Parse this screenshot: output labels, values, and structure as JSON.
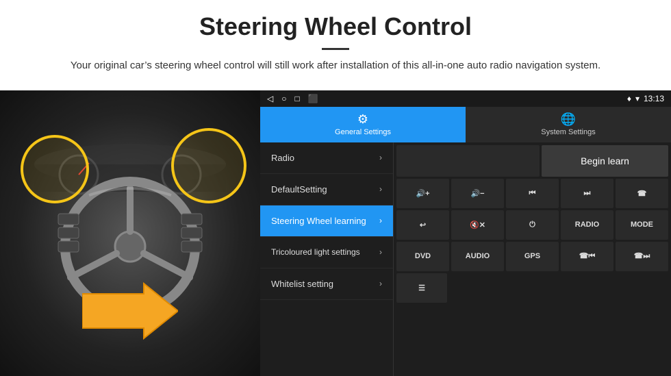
{
  "header": {
    "title": "Steering Wheel Control",
    "subtitle": "Your original car’s steering wheel control will still work after installation of this all-in-one auto radio navigation system."
  },
  "statusBar": {
    "time": "13:13",
    "icons": [
      "◁",
      "○",
      "□",
      "⬜"
    ]
  },
  "tabs": [
    {
      "id": "general",
      "label": "General Settings",
      "active": true
    },
    {
      "id": "system",
      "label": "System Settings",
      "active": false
    }
  ],
  "menu": {
    "items": [
      {
        "id": "radio",
        "label": "Radio",
        "active": false
      },
      {
        "id": "defaultsetting",
        "label": "DefaultSetting",
        "active": false
      },
      {
        "id": "steering",
        "label": "Steering Wheel learning",
        "active": true
      },
      {
        "id": "tricoloured",
        "label": "Tricoloured light settings",
        "active": false
      },
      {
        "id": "whitelist",
        "label": "Whitelist setting",
        "active": false
      }
    ]
  },
  "controls": {
    "beginLearnLabel": "Begin learn",
    "row2": [
      {
        "id": "vol-up",
        "symbol": "🔊+",
        "label": "vol-up"
      },
      {
        "id": "vol-down",
        "symbol": "🔊−",
        "label": "vol-down"
      },
      {
        "id": "prev-track",
        "symbol": "⏮",
        "label": "prev-track"
      },
      {
        "id": "next-track",
        "symbol": "⏭",
        "label": "next-track"
      },
      {
        "id": "call",
        "symbol": "☎",
        "label": "call"
      }
    ],
    "row3": [
      {
        "id": "hang-up",
        "symbol": "☇",
        "label": "hang-up"
      },
      {
        "id": "mute",
        "symbol": "🔇×",
        "label": "mute"
      },
      {
        "id": "power",
        "symbol": "⏻",
        "label": "power"
      },
      {
        "id": "radio-btn",
        "symbol": "RADIO",
        "label": "radio-mode"
      },
      {
        "id": "mode-btn",
        "symbol": "MODE",
        "label": "mode"
      }
    ],
    "row4": [
      {
        "id": "dvd",
        "symbol": "DVD",
        "label": "dvd"
      },
      {
        "id": "audio",
        "symbol": "AUDIO",
        "label": "audio"
      },
      {
        "id": "gps",
        "symbol": "GPS",
        "label": "gps"
      },
      {
        "id": "tel-prev",
        "symbol": "☎⏮",
        "label": "tel-prev"
      },
      {
        "id": "tel-next",
        "symbol": "☎⏭",
        "label": "tel-next"
      }
    ],
    "row5": [
      {
        "id": "list",
        "symbol": "☰",
        "label": "list"
      }
    ]
  }
}
